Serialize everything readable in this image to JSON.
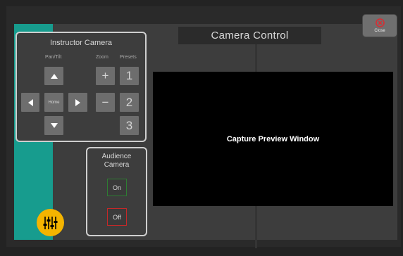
{
  "header": {
    "title": "Camera Control"
  },
  "close_button": {
    "label": "Close",
    "icon": "close-circle-icon",
    "color": "#e0282e"
  },
  "instructor_camera": {
    "title": "Instructor Camera",
    "pan_tilt_label": "Pan/Tilt",
    "zoom_label": "Zoom",
    "presets_label": "Presets",
    "home_label": "Home",
    "zoom_in": "+",
    "zoom_out": "−",
    "presets": [
      "1",
      "2",
      "3"
    ]
  },
  "audience_camera": {
    "title_line1": "Audience",
    "title_line2": "Camera",
    "on_label": "On",
    "off_label": "Off",
    "on_color": "#2e7d32",
    "off_color": "#c62828"
  },
  "preview": {
    "label": "Capture Preview Window"
  },
  "mixer_button": {
    "icon": "mixer-sliders-icon",
    "color": "#f4b400"
  },
  "colors": {
    "teal": "#179c8e",
    "panel": "#3d3d3d",
    "button": "#6e6e6e"
  }
}
